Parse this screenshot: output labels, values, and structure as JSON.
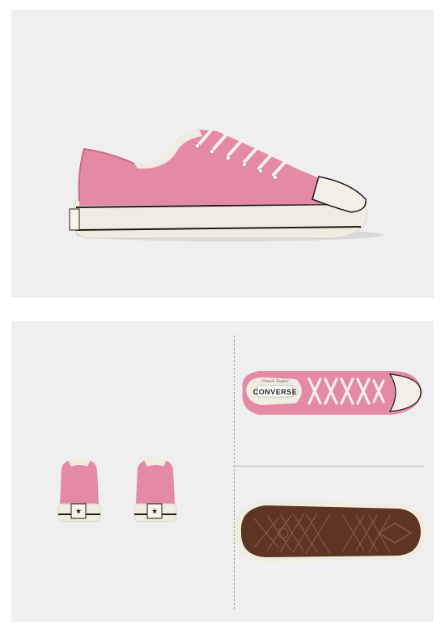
{
  "product": {
    "brand_label_text": "CONVERSE",
    "tongue_script_text": "Chuck Taylor"
  },
  "colors": {
    "canvas_pink": "#e48aa4",
    "canvas_pink_dark": "#c86a86",
    "rubber_cream": "#f1ece1",
    "sole_brown": "#5e3524",
    "stripe_black": "#1b1b1b",
    "panel_bg": "#efefef"
  },
  "views": [
    {
      "name": "side-profile"
    },
    {
      "name": "rear-pair"
    },
    {
      "name": "top-down"
    },
    {
      "name": "outsole"
    }
  ]
}
